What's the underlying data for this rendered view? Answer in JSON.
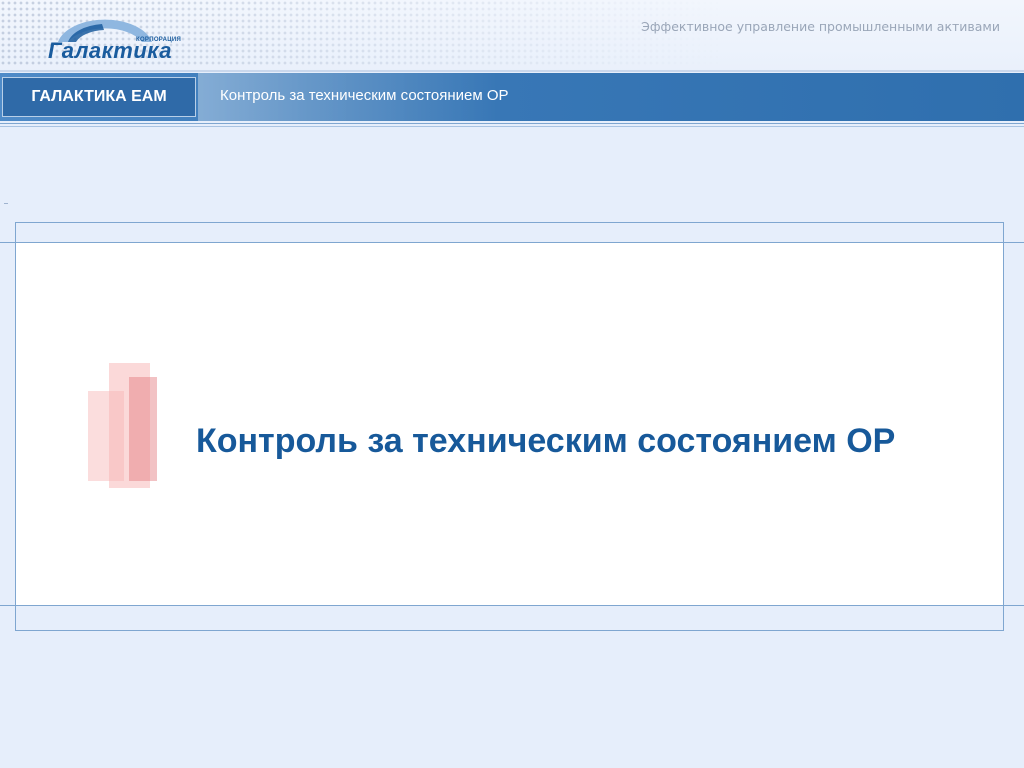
{
  "header": {
    "logo_brand": "Галактика",
    "logo_small": "КОРПОРАЦИЯ",
    "tagline": "Эффективное управление промышленными активами"
  },
  "nav": {
    "product": "ГАЛАКТИКА ЕАМ",
    "title": "Контроль за техническим состоянием ОР"
  },
  "slide": {
    "title": "Контроль за техническим состоянием ОР"
  },
  "colors": {
    "brand_blue": "#1a5c9e",
    "nav_blue": "#2f6fae",
    "title_blue": "#17599a",
    "accent_pink": "#e2787d"
  }
}
